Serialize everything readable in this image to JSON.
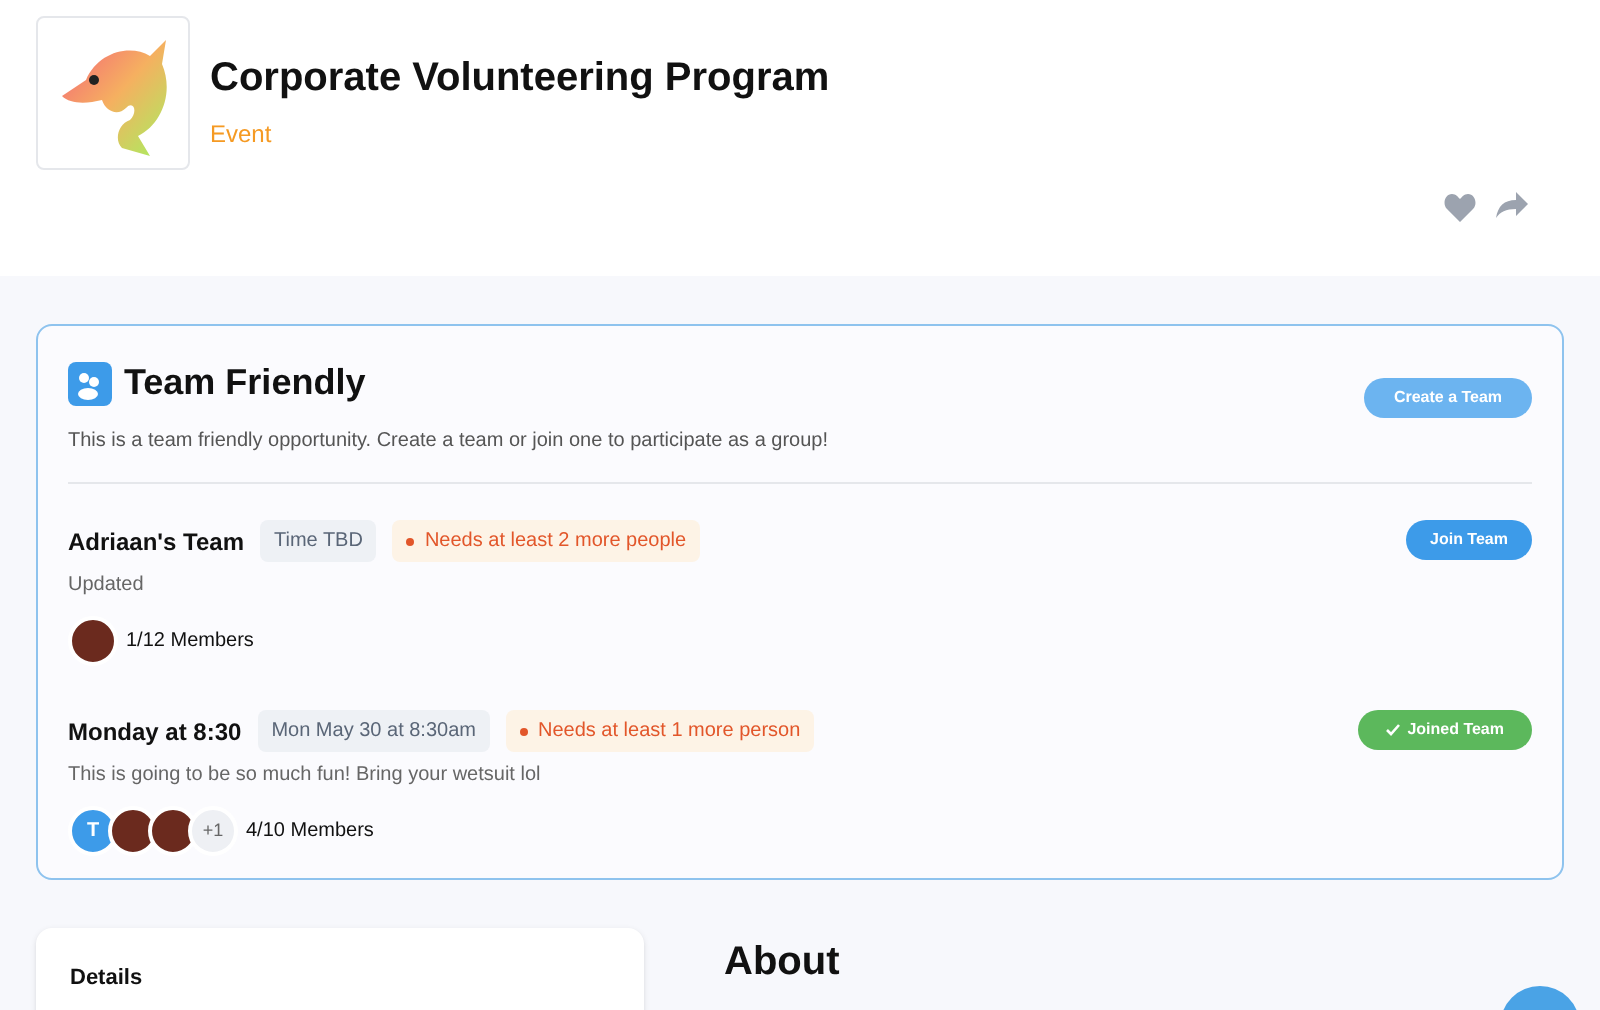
{
  "header": {
    "title": "Corporate Volunteering Program",
    "subtitle": "Event"
  },
  "team_section": {
    "title": "Team Friendly",
    "description": "This is a team friendly opportunity. Create a team or join one to participate as a group!",
    "create_button": "Create a Team",
    "teams": [
      {
        "name": "Adriaan's Team",
        "time": "Time TBD",
        "needs": "Needs at least 2 more people",
        "description": "Updated",
        "joined": false,
        "button": "Join Team",
        "members": [
          {
            "kind": "photo"
          }
        ],
        "member_count": "1/12 Members"
      },
      {
        "name": "Monday at 8:30",
        "time": "Mon May 30 at 8:30am",
        "needs": "Needs at least 1 more person",
        "description": "This is going to be so much fun! Bring your wetsuit lol",
        "joined": true,
        "button": "Joined Team",
        "members": [
          {
            "kind": "letter",
            "text": "T"
          },
          {
            "kind": "photo"
          },
          {
            "kind": "photo"
          },
          {
            "kind": "more",
            "text": "+1"
          }
        ],
        "member_count": "4/10 Members"
      }
    ]
  },
  "details": {
    "title": "Details"
  },
  "about": {
    "title": "About"
  }
}
